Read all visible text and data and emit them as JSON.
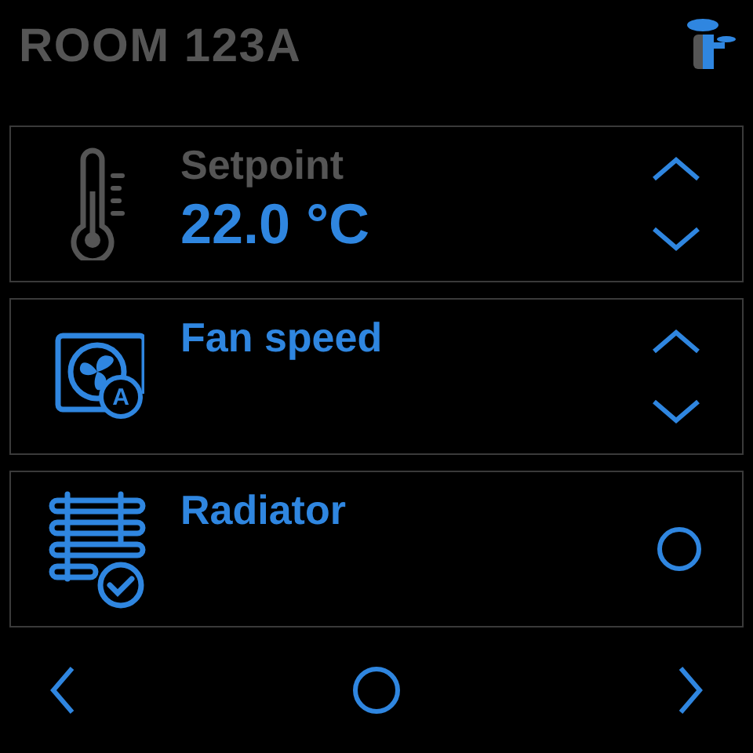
{
  "header": {
    "title": "ROOM 123A"
  },
  "rows": [
    {
      "kind": "stepper",
      "label": "Setpoint",
      "value": "22.0 °C"
    },
    {
      "kind": "stepper",
      "badge": "A",
      "label": "Fan speed"
    },
    {
      "kind": "toggle",
      "label": "Radiator",
      "on": false
    }
  ]
}
